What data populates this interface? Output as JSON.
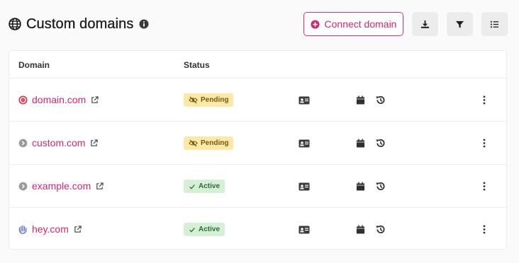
{
  "header": {
    "title": "Custom domains",
    "connect_label": "Connect domain"
  },
  "table": {
    "col_domain": "Domain",
    "col_status": "Status"
  },
  "rows": [
    {
      "domain": "domain.com",
      "status": "Pending",
      "icon": "red-circle-icon"
    },
    {
      "domain": "custom.com",
      "status": "Pending",
      "icon": "gray-chevron-icon"
    },
    {
      "domain": "example.com",
      "status": "Active",
      "icon": "gray-chevron-icon"
    },
    {
      "domain": "hey.com",
      "status": "Active",
      "icon": "hand-wave-icon"
    }
  ],
  "colors": {
    "accent": "#d6266f",
    "pending_bg": "#fde9a5",
    "active_bg": "#d6f0d8"
  }
}
